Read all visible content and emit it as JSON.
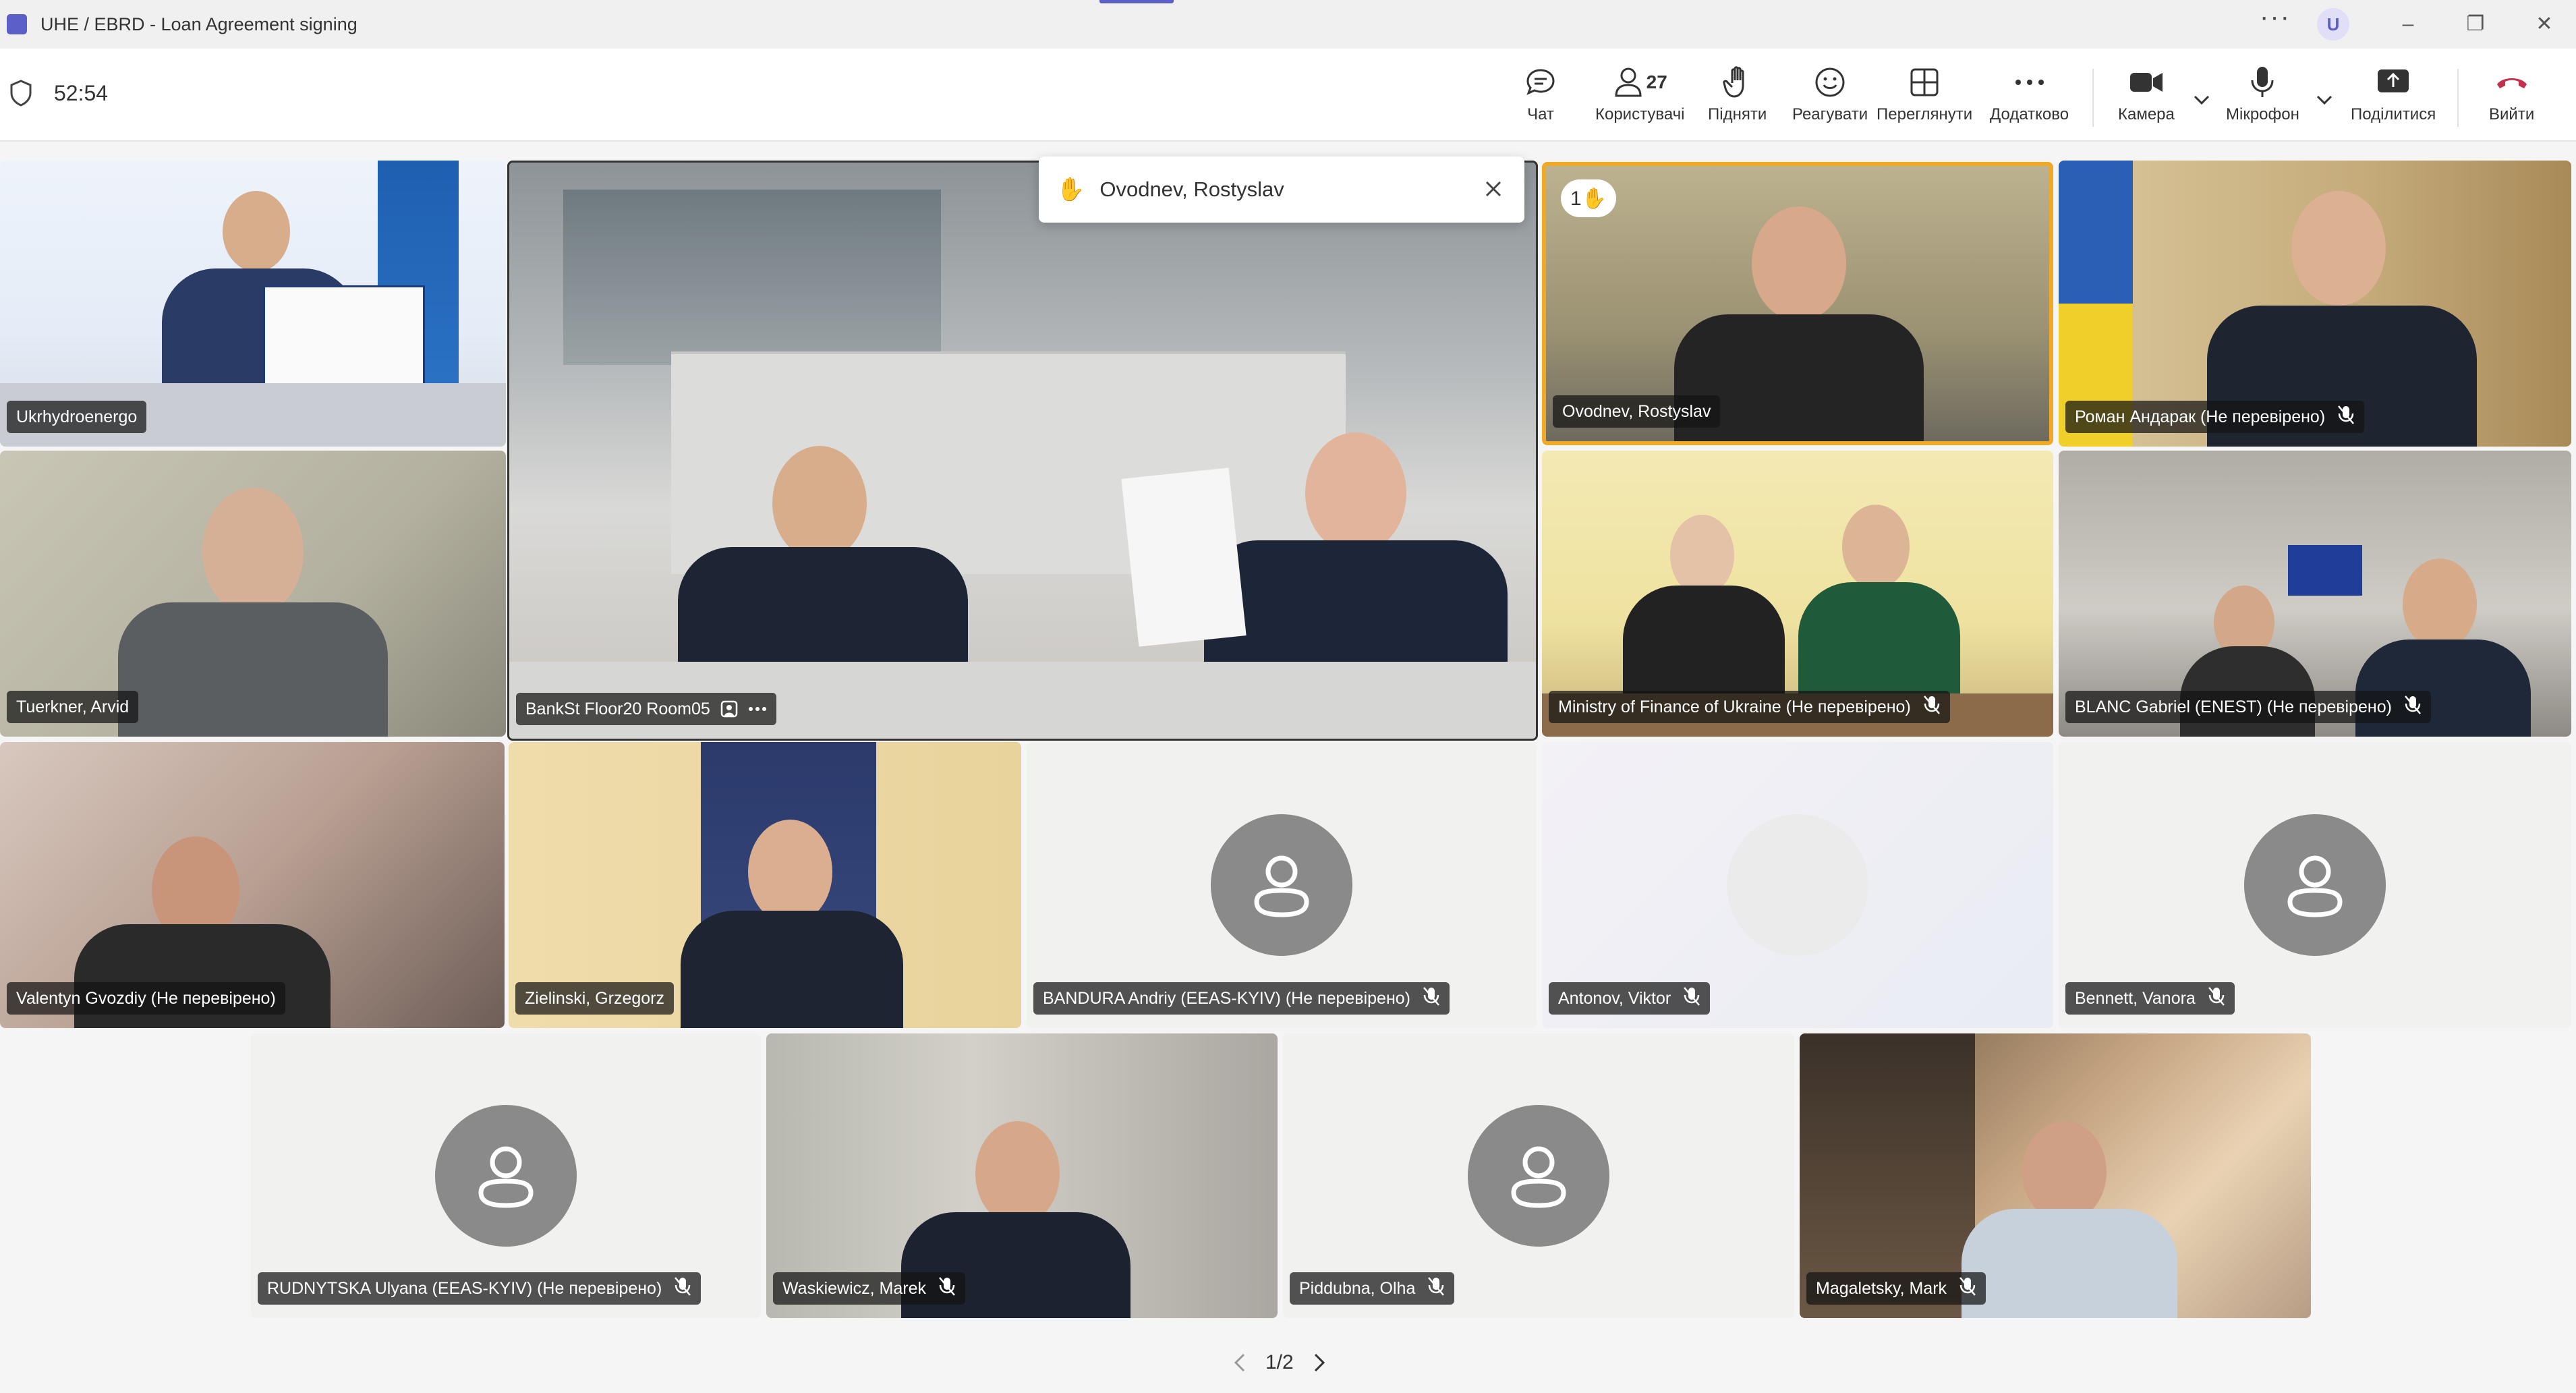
{
  "window": {
    "title": "UHE / EBRD - Loan Agreement signing",
    "more_glyph": "···",
    "user_initial": "U",
    "minimize_glyph": "–",
    "restore_glyph": "❐",
    "close_glyph": "✕"
  },
  "meeting": {
    "timer": "52:54",
    "participant_count": "27"
  },
  "toolbar": {
    "chat": "Чат",
    "people": "Користувачі",
    "raise": "Підняти",
    "react": "Реагувати",
    "view": "Переглянути",
    "more": "Додатково",
    "camera": "Камера",
    "mic": "Мікрофон",
    "share": "Поділитися",
    "leave": "Вийти"
  },
  "colors": {
    "accent": "#5b5fc7",
    "leave": "#c4314b",
    "highlight": "#f0a925"
  },
  "toast": {
    "hand_glyph": "✋",
    "name": "Ovodnev, Rostyslav"
  },
  "raised_hand_badge": "1✋",
  "tiles": [
    {
      "name": "Ukrhydroenergo"
    },
    {
      "name": "BankSt Floor20 Room05"
    },
    {
      "name": "Ovodnev, Rostyslav"
    },
    {
      "name": "Роман Андарак (Не перевірено)"
    },
    {
      "name": "Tuerkner, Arvid"
    },
    {
      "name": "Ministry of Finance of Ukraine (Не перевірено)"
    },
    {
      "name": "BLANC Gabriel (ENEST) (Не перевірено)"
    },
    {
      "name": "Valentyn Gvozdiy (Не перевірено)"
    },
    {
      "name": "Zielinski, Grzegorz"
    },
    {
      "name": "BANDURA Andriy (EEAS-KYIV) (Не перевірено)"
    },
    {
      "name": "Antonov, Viktor"
    },
    {
      "name": "Bennett, Vanora"
    },
    {
      "name": "RUDNYTSKA Ulyana (EEAS-KYIV) (Не перевірено)"
    },
    {
      "name": "Waskiewicz, Marek"
    },
    {
      "name": "Piddubna, Olha"
    },
    {
      "name": "Magaletsky, Mark"
    }
  ],
  "pager": {
    "label": "1/2"
  }
}
